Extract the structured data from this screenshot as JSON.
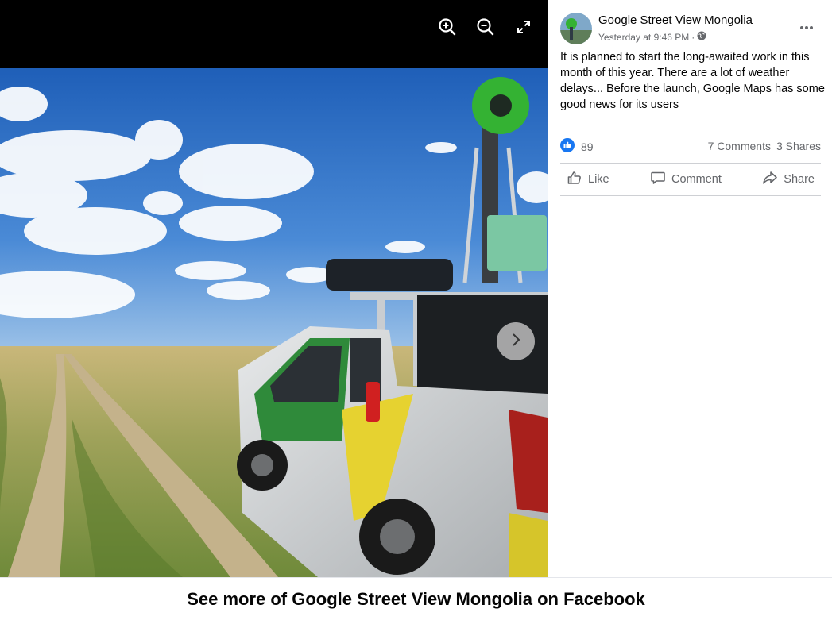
{
  "viewer": {
    "controls": {
      "zoom_in": "zoom-in-icon",
      "zoom_out": "zoom-out-icon",
      "fullscreen": "fullscreen-icon"
    },
    "next": "chevron-right-icon"
  },
  "post": {
    "page_name": "Google Street View Mongolia",
    "timestamp": "Yesterday at 9:46 PM",
    "separator": "·",
    "text": "It is planned to start the long-awaited work in this month of this year. There are a lot of weather delays... Before the launch, Google Maps has some good news for its users",
    "likes": "89",
    "comments": "7 Comments",
    "shares": "3 Shares",
    "actions": {
      "like": "Like",
      "comment": "Comment",
      "share": "Share"
    }
  },
  "footer": {
    "text": "See more of Google Street View Mongolia on Facebook"
  },
  "colors": {
    "like_blue": "#1877f2",
    "secondary_text": "#65676b",
    "primary_text": "#050505"
  }
}
